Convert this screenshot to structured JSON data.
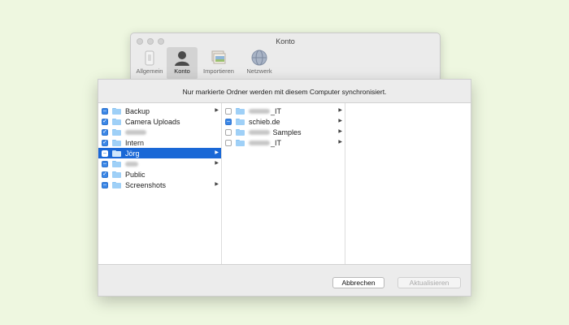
{
  "window": {
    "title": "Konto",
    "toolbar": [
      {
        "label": "Allgemein",
        "icon": "general-icon"
      },
      {
        "label": "Konto",
        "icon": "account-icon",
        "active": true
      },
      {
        "label": "Importieren",
        "icon": "import-icon"
      },
      {
        "label": "Netzwerk",
        "icon": "network-icon"
      }
    ]
  },
  "sheet": {
    "message": "Nur markierte Ordner werden mit diesem Computer synchronisiert.",
    "columns": [
      [
        {
          "label": "Backup",
          "check": "mixed",
          "arrow": true
        },
        {
          "label": "Camera Uploads",
          "check": "checked",
          "arrow": false
        },
        {
          "label": "",
          "check": "checked",
          "arrow": false,
          "blurred": true
        },
        {
          "label": "Intern",
          "check": "checked",
          "arrow": false
        },
        {
          "label": "Jörg",
          "check": "mixed",
          "arrow": true,
          "selected": true
        },
        {
          "label": "",
          "check": "mixed",
          "arrow": true,
          "blurred": true,
          "short": true
        },
        {
          "label": "Public",
          "check": "checked",
          "arrow": false
        },
        {
          "label": "Screenshots",
          "check": "mixed",
          "arrow": true
        }
      ],
      [
        {
          "label": "_IT",
          "check": "empty",
          "arrow": true,
          "blurred": true
        },
        {
          "label": "schieb.de",
          "check": "mixed",
          "arrow": true
        },
        {
          "label": " Samples",
          "check": "empty",
          "arrow": true,
          "blurred": true
        },
        {
          "label": "_IT",
          "check": "empty",
          "arrow": true,
          "blurred": true
        }
      ],
      []
    ],
    "buttons": {
      "cancel": "Abbrechen",
      "update": "Aktualisieren"
    }
  },
  "colors": {
    "background": "#eef7e0",
    "selection": "#1a68d6",
    "checkbox": "#3b87e6"
  }
}
